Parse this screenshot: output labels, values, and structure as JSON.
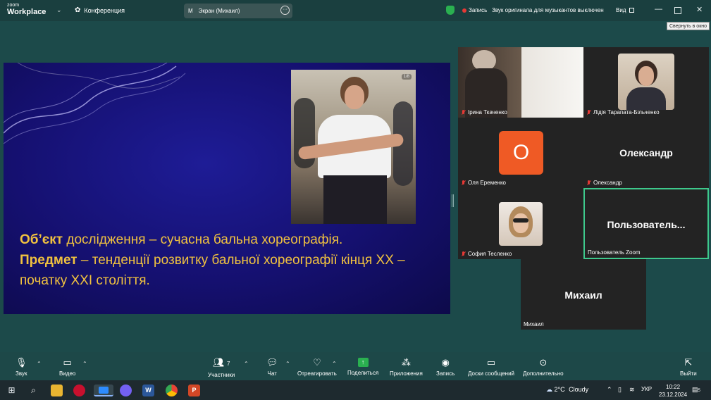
{
  "app": {
    "brand_small": "zoom",
    "brand_big": "Workplace",
    "conference_label": "Конференция",
    "screen_share": {
      "avatar": "M",
      "label": "Экран (Михаил)"
    },
    "recording_label": "Запись",
    "original_sound": "Звук оригинала для музыкантов выключен",
    "view_label": "Вид",
    "tooltip": "Свернуть в окно",
    "colors": {
      "accent_green": "#2ab050",
      "record_red": "#e53935",
      "active_speaker": "#3ec98c",
      "topbar": "#1a3f3f"
    }
  },
  "slide": {
    "photo_badge": "1/8",
    "line1_bold": "Об’єкт",
    "line1_rest": " дослідження – сучасна бальна хореографія.",
    "line2_bold": "Предмет",
    "line2_rest": "  – тенденції розвитку бальної хореографії кінця ХХ – початку ХХІ століття.",
    "colors": {
      "background": "#151070",
      "text": "#f1c23f"
    }
  },
  "participants": [
    {
      "name": "Ірина Ткаченко",
      "muted": true
    },
    {
      "name": "Лідія Тарапата-Більченко",
      "muted": true
    },
    {
      "name": "Оля Еременко",
      "muted": true,
      "avatar_letter": "О",
      "avatar_color": "#ef5a25"
    },
    {
      "name": "Олександр",
      "muted": true,
      "display": "Олександр"
    },
    {
      "name": "София Тесленко",
      "muted": true
    },
    {
      "name": "Пользователь Zoom",
      "muted": false,
      "display": "Пользователь..."
    },
    {
      "name": "Михаил",
      "muted": false,
      "display": "Михаил"
    }
  ],
  "toolbar": {
    "audio": "Звук",
    "video": "Видео",
    "participants": "Участники",
    "participants_count": "7",
    "chat": "Чат",
    "react": "Отреагировать",
    "share": "Поделиться",
    "apps": "Приложения",
    "record": "Запись",
    "boards": "Доски сообщений",
    "more": "Дополнительно",
    "leave": "Выйти"
  },
  "taskbar": {
    "weather_temp": "2°C",
    "weather_text": "Cloudy",
    "lang": "УКР",
    "time": "10:22",
    "date": "23.12.2024",
    "notifications": "5"
  }
}
